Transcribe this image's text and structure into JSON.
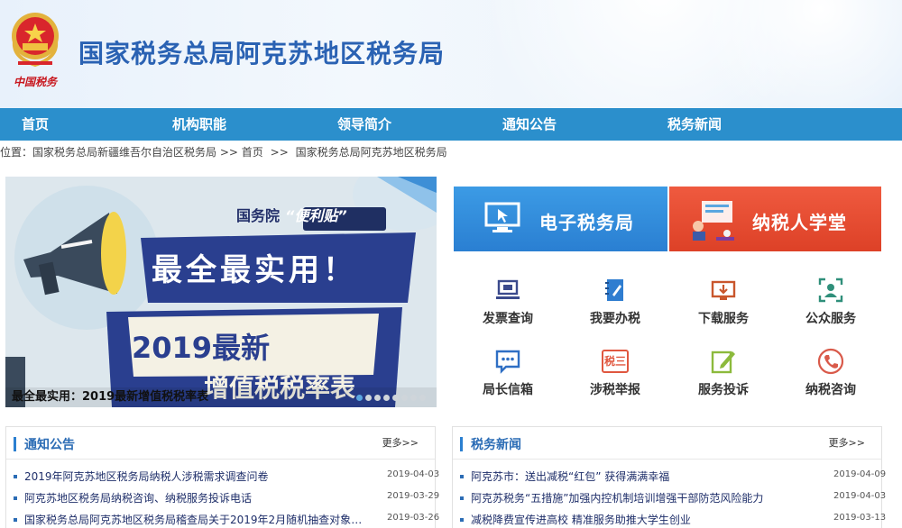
{
  "header": {
    "title": "国家税务总局阿克苏地区税务局",
    "emblem_text": "中国税务",
    "brand_color": "#2a62b3"
  },
  "nav": {
    "items": [
      {
        "label": "首页"
      },
      {
        "label": "机构职能"
      },
      {
        "label": "领导简介"
      },
      {
        "label": "通知公告"
      },
      {
        "label": "税务新闻"
      }
    ],
    "bg_color": "#2b8fcc"
  },
  "breadcrumb": {
    "prefix": "位置：",
    "items": [
      "国家税务总局新疆维吾尔自治区税务局",
      "首页",
      "国家税务总局阿克苏地区税务局"
    ],
    "separator": ">>"
  },
  "banner": {
    "tag": "国务院",
    "tag_highlight": "“便利贴”",
    "headline": "最全最实用！",
    "subheadline": "2019最新",
    "subheadline_cut": "增值税税率表",
    "caption": "最全最实用：2019最新增值税税率表",
    "slide_count": 8,
    "active_slide": 1
  },
  "tiles": {
    "etax": {
      "label": "电子税务局",
      "icon": "monitor-cursor-icon",
      "color": "#2a7fd2"
    },
    "school": {
      "label": "纳税人学堂",
      "icon": "classroom-icon",
      "color": "#dd4127"
    }
  },
  "services": [
    {
      "label": "发票查询",
      "icon": "laptop-icon"
    },
    {
      "label": "我要办税",
      "icon": "notebook-pen-icon"
    },
    {
      "label": "下载服务",
      "icon": "download-monitor-icon"
    },
    {
      "label": "公众服务",
      "icon": "user-frame-icon"
    },
    {
      "label": "局长信箱",
      "icon": "chat-bubble-icon"
    },
    {
      "label": "涉税举报",
      "icon": "tax-report-icon",
      "icon_text": "税三"
    },
    {
      "label": "服务投诉",
      "icon": "edit-icon"
    },
    {
      "label": "纳税咨询",
      "icon": "phone-icon"
    }
  ],
  "notices": {
    "title": "通知公告",
    "more": "更多>>",
    "items": [
      {
        "text": "2019年阿克苏地区税务局纳税人涉税需求调查问卷",
        "date": "2019-04-03"
      },
      {
        "text": "阿克苏地区税务局纳税咨询、纳税服务投诉电话",
        "date": "2019-03-29"
      },
      {
        "text": "国家税务总局阿克苏地区税务局稽查局关于2019年2月随机抽查对象抽...",
        "date": "2019-03-26"
      }
    ]
  },
  "news": {
    "title": "税务新闻",
    "more": "更多>>",
    "items": [
      {
        "text": "阿克苏市：送出减税“红包” 获得满满幸福",
        "date": "2019-04-09"
      },
      {
        "text": "阿克苏税务“五措施”加强内控机制培训增强干部防范风险能力",
        "date": "2019-04-03"
      },
      {
        "text": "减税降费宣传进高校 精准服务助推大学生创业",
        "date": "2019-03-13"
      }
    ]
  }
}
